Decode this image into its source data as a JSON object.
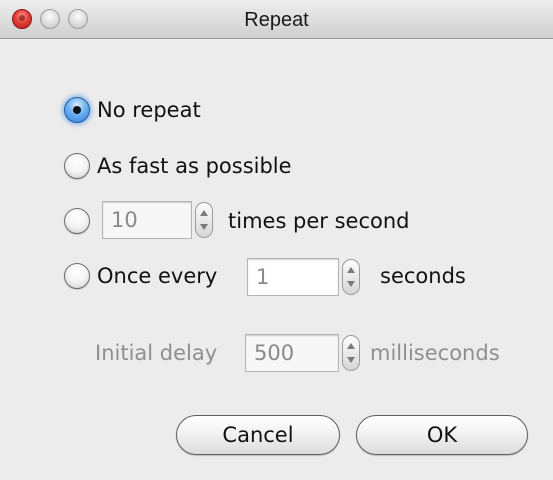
{
  "window": {
    "title": "Repeat"
  },
  "options": [
    {
      "label": "No repeat",
      "selected": true
    },
    {
      "label": "As fast as possible",
      "selected": false
    },
    {
      "value": "10",
      "suffix": "times per second",
      "selected": false
    },
    {
      "prefix": "Once every",
      "value": "1",
      "suffix": "seconds",
      "selected": false
    }
  ],
  "initial_delay": {
    "label": "Initial delay",
    "value": "500",
    "unit": "milliseconds"
  },
  "buttons": {
    "cancel_label": "Cancel",
    "ok_label": "OK"
  },
  "icons": {
    "close": "close-icon",
    "minimize": "minimize-icon",
    "zoom": "zoom-icon",
    "stepper_up": "chevron-up-icon",
    "stepper_down": "chevron-down-icon"
  }
}
